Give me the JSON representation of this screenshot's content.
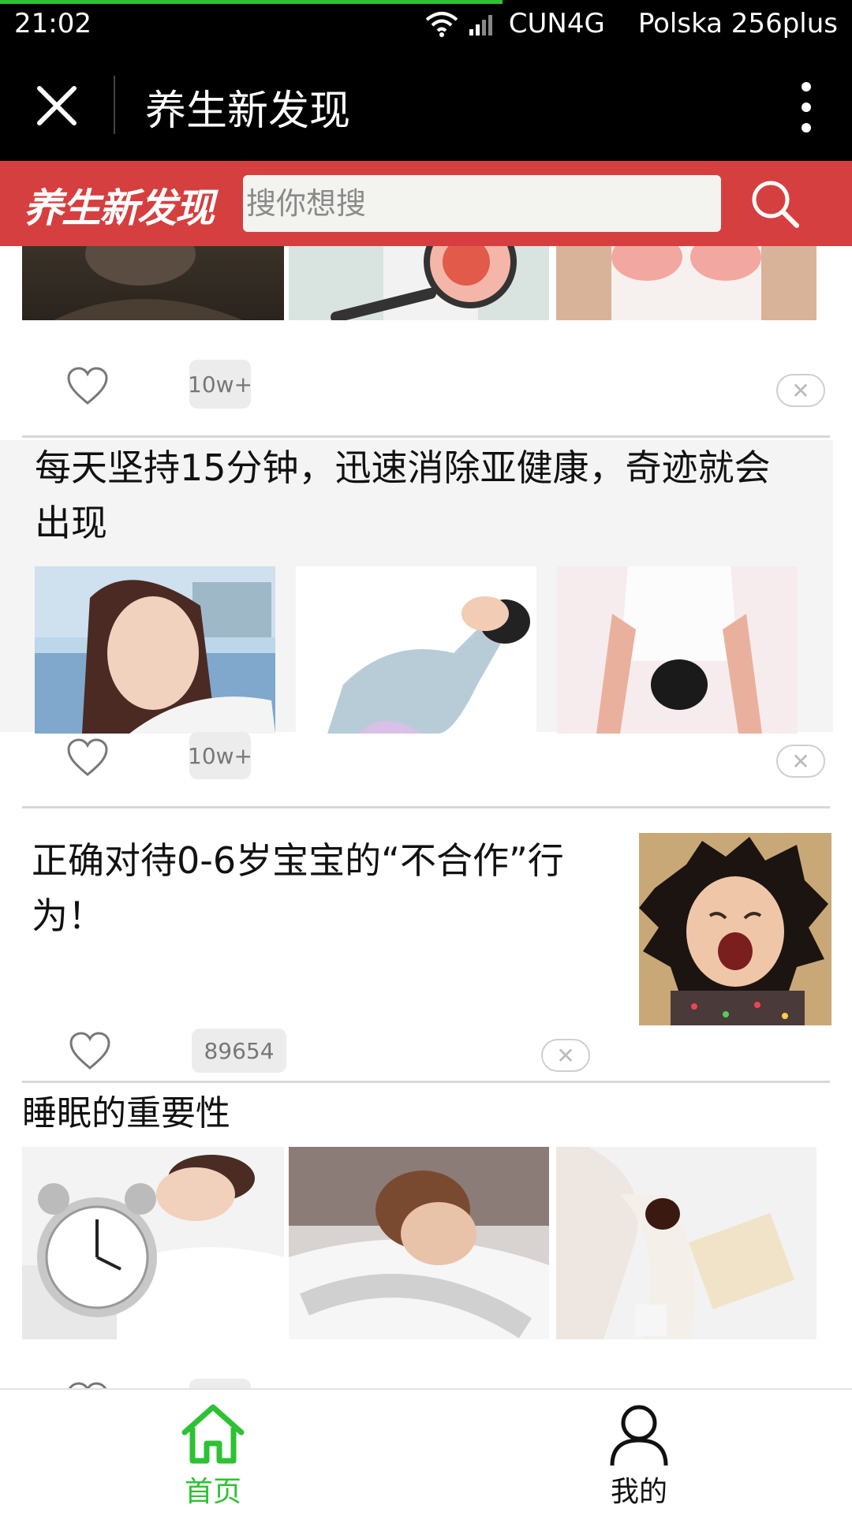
{
  "status": {
    "time": "21:02",
    "carrier": "CUN4G",
    "operator": "Polska 256plus"
  },
  "titlebar": {
    "title": "养生新发现"
  },
  "header": {
    "logo": "养生新发现",
    "search_placeholder": "搜你想搜"
  },
  "feed": {
    "items": [
      {
        "count": "10w+"
      },
      {
        "title": "每天坚持15分钟，迅速消除亚健康，奇迹就会出现",
        "count": "10w+"
      },
      {
        "title": "正确对待0-6岁宝宝的“不合作”行为！",
        "count": "89654"
      },
      {
        "title": "睡眠的重要性"
      }
    ]
  },
  "nav": {
    "home": "首页",
    "mine": "我的"
  },
  "colors": {
    "header_red": "#d63f3f",
    "active_green": "#2ec134"
  }
}
